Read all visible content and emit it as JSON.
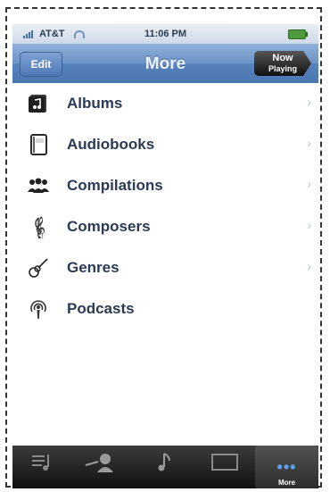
{
  "status": {
    "carrier": "AT&T",
    "time": "11:06 PM"
  },
  "nav": {
    "title": "More",
    "edit_label": "Edit",
    "nowplaying_line1": "Now",
    "nowplaying_line2": "Playing"
  },
  "list": {
    "items": [
      {
        "label": "Albums",
        "icon": "album-icon"
      },
      {
        "label": "Audiobooks",
        "icon": "book-icon"
      },
      {
        "label": "Compilations",
        "icon": "people-icon"
      },
      {
        "label": "Composers",
        "icon": "treble-clef-icon"
      },
      {
        "label": "Genres",
        "icon": "guitar-icon"
      },
      {
        "label": "Podcasts",
        "icon": "podcast-icon"
      }
    ]
  },
  "tabs": [
    {
      "icon": "playlists-icon",
      "label": ""
    },
    {
      "icon": "artists-icon",
      "label": ""
    },
    {
      "icon": "songs-icon",
      "label": ""
    },
    {
      "icon": "videos-icon",
      "label": ""
    },
    {
      "icon": "more-icon",
      "label": "More"
    }
  ],
  "colors": {
    "nav": "#5782bc",
    "label": "#2b3a57",
    "tabbar": "#1a1a1a",
    "selected_tab": "#5ea2f0"
  }
}
